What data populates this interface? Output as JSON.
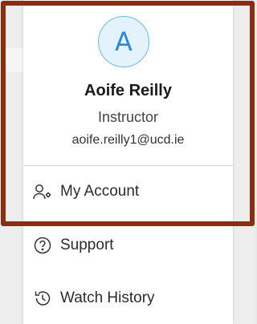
{
  "profile": {
    "avatar_initial": "A",
    "name": "Aoife Reilly",
    "role": "Instructor",
    "email": "aoife.reilly1@ucd.ie"
  },
  "menu": {
    "items": [
      {
        "label": "My Account",
        "icon": "account-settings-icon"
      },
      {
        "label": "Support",
        "icon": "help-circle-icon"
      },
      {
        "label": "Watch History",
        "icon": "history-icon"
      }
    ]
  },
  "colors": {
    "highlight_border": "#8b2e0f",
    "avatar_accent": "#2a88d4",
    "avatar_fill": "#e4f2fc"
  }
}
